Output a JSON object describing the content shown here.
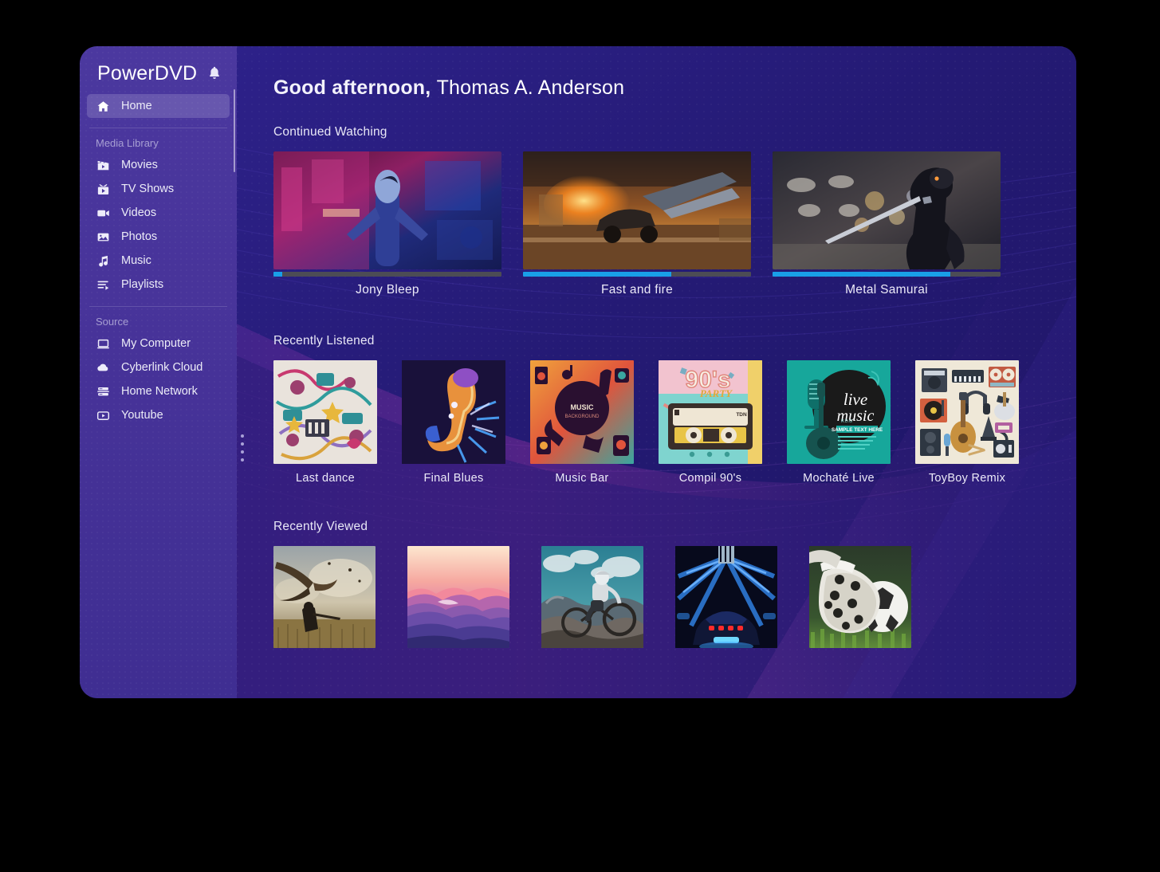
{
  "app": {
    "brand": "PowerDVD",
    "notification_icon": "bell-icon",
    "window_bg": "#241a72",
    "sidebar_bg": "#47339a",
    "accent": "#199fe8"
  },
  "sidebar": {
    "home": {
      "label": "Home",
      "icon": "home-icon",
      "active": true
    },
    "media_library": {
      "label": "Media Library",
      "items": [
        {
          "label": "Movies",
          "icon": "clapperboard-icon"
        },
        {
          "label": "TV Shows",
          "icon": "tv-icon"
        },
        {
          "label": "Videos",
          "icon": "video-camera-icon"
        },
        {
          "label": "Photos",
          "icon": "photo-icon"
        },
        {
          "label": "Music",
          "icon": "music-note-icon"
        },
        {
          "label": "Playlists",
          "icon": "playlist-icon"
        }
      ]
    },
    "source": {
      "label": "Source",
      "items": [
        {
          "label": "My Computer",
          "icon": "laptop-icon"
        },
        {
          "label": "Cyberlink Cloud",
          "icon": "cloud-icon"
        },
        {
          "label": "Home Network",
          "icon": "server-icon"
        },
        {
          "label": "Youtube",
          "icon": "youtube-icon"
        }
      ]
    }
  },
  "main": {
    "greeting_prefix": "Good afternoon, ",
    "user_name": "Thomas A. Anderson",
    "sections": {
      "continued_watching": {
        "title": "Continued Watching",
        "items": [
          {
            "title": "Jony Bleep",
            "progress": 4,
            "art": "neon-man-thumb"
          },
          {
            "title": "Fast and fire",
            "progress": 65,
            "art": "car-chase-thumb"
          },
          {
            "title": "Metal Samurai",
            "progress": 78,
            "art": "samurai-thumb"
          }
        ]
      },
      "recently_listened": {
        "title": "Recently Listened",
        "items": [
          {
            "title": "Last dance",
            "art": "doodle-album"
          },
          {
            "title": "Final Blues",
            "art": "saxophone-album"
          },
          {
            "title": "Music Bar",
            "art": "music-bar-album"
          },
          {
            "title": "Compil 90's",
            "art": "cassette-90s-album"
          },
          {
            "title": "Mochaté Live",
            "art": "live-music-album"
          },
          {
            "title": "ToyBoy Remix",
            "art": "instruments-album"
          }
        ]
      },
      "recently_viewed": {
        "title": "Recently Viewed",
        "items": [
          {
            "art": "dragon-photo"
          },
          {
            "art": "mountain-sunset-photo"
          },
          {
            "art": "mountain-biker-photo"
          },
          {
            "art": "blue-car-tunnel-photo"
          },
          {
            "art": "soccer-boot-photo"
          }
        ]
      }
    }
  }
}
